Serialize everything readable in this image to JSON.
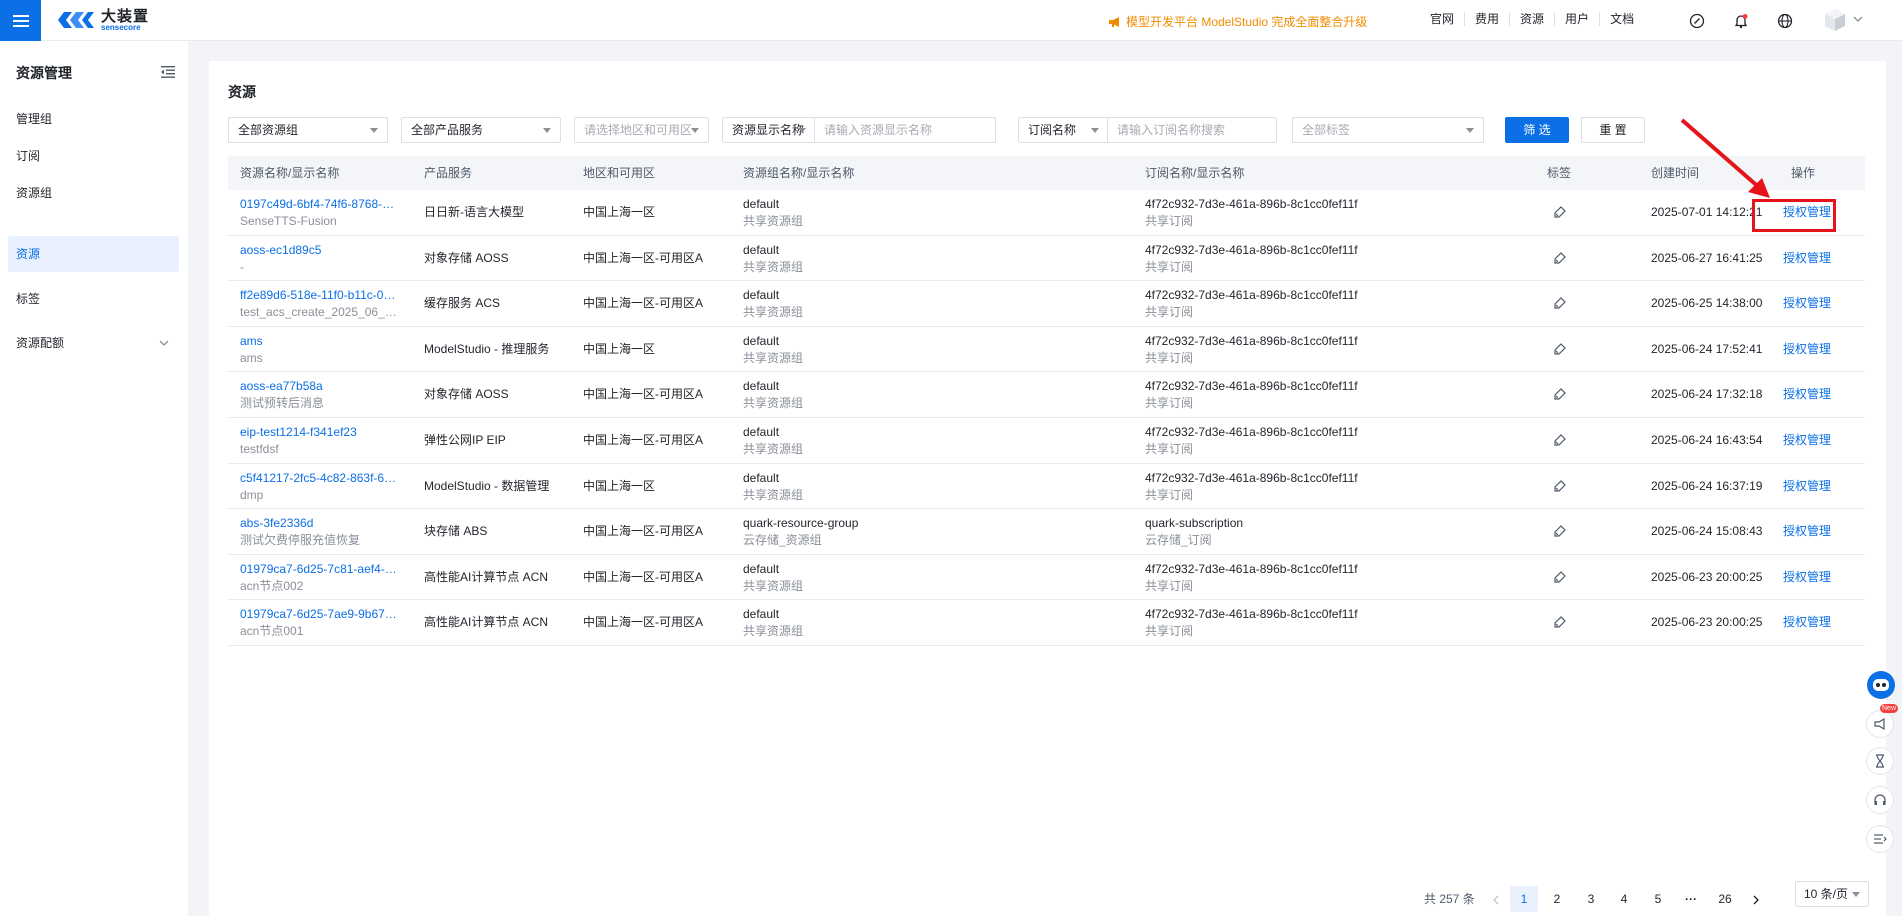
{
  "header": {
    "logo_cn": "大装置",
    "logo_en": "sensecore",
    "notice": "模型开发平台 ModelStudio 完成全面整合升级",
    "nav": [
      "官网",
      "费用",
      "资源",
      "用户",
      "文档"
    ]
  },
  "sidebar": {
    "title": "资源管理",
    "items": [
      {
        "label": "管理组",
        "active": false
      },
      {
        "label": "订阅",
        "active": false
      },
      {
        "label": "资源组",
        "active": false
      },
      {
        "label": "资源",
        "active": true
      },
      {
        "label": "标签",
        "active": false
      },
      {
        "label": "资源配额",
        "active": false
      }
    ]
  },
  "page": {
    "title": "资源"
  },
  "filters": {
    "resource_group": "全部资源组",
    "product": "全部产品服务",
    "region_placeholder": "请选择地区和可用区",
    "display_name_type": "资源显示名称",
    "display_name_placeholder": "请输入资源显示名称",
    "subscription_type": "订阅名称",
    "subscription_placeholder": "请输入订阅名称搜索",
    "tags_placeholder": "全部标签",
    "filter_button": "筛 选",
    "reset_button": "重 置"
  },
  "table": {
    "columns": [
      "资源名称/显示名称",
      "产品服务",
      "地区和可用区",
      "资源组名称/显示名称",
      "订阅名称/显示名称",
      "标签",
      "创建时间",
      "操作"
    ],
    "rows": [
      {
        "name": "0197c49d-6bf4-74f6-8768-c0…",
        "display": "SenseTTS-Fusion",
        "product": "日日新-语言大模型",
        "region": "中国上海一区",
        "group": "default",
        "group_display": "共享资源组",
        "sub": "4f72c932-7d3e-461a-896b-8c1cc0fef11f",
        "sub_display": "共享订阅",
        "time": "2025-07-01 14:12:21",
        "op": "授权管理"
      },
      {
        "name": "aoss-ec1d89c5",
        "display": "-",
        "product": "对象存储 AOSS",
        "region": "中国上海一区-可用区A",
        "group": "default",
        "group_display": "共享资源组",
        "sub": "4f72c932-7d3e-461a-896b-8c1cc0fef11f",
        "sub_display": "共享订阅",
        "time": "2025-06-27 16:41:25",
        "op": "授权管理"
      },
      {
        "name": "ff2e89d6-518e-11f0-b11c-043…",
        "display": "test_acs_create_2025_06_2…",
        "product": "缓存服务 ACS",
        "region": "中国上海一区-可用区A",
        "group": "default",
        "group_display": "共享资源组",
        "sub": "4f72c932-7d3e-461a-896b-8c1cc0fef11f",
        "sub_display": "共享订阅",
        "time": "2025-06-25 14:38:00",
        "op": "授权管理"
      },
      {
        "name": "ams",
        "display": "ams",
        "product": "ModelStudio - 推理服务",
        "region": "中国上海一区",
        "group": "default",
        "group_display": "共享资源组",
        "sub": "4f72c932-7d3e-461a-896b-8c1cc0fef11f",
        "sub_display": "共享订阅",
        "time": "2025-06-24 17:52:41",
        "op": "授权管理"
      },
      {
        "name": "aoss-ea77b58a",
        "display": "测试预转后消息",
        "product": "对象存储 AOSS",
        "region": "中国上海一区-可用区A",
        "group": "default",
        "group_display": "共享资源组",
        "sub": "4f72c932-7d3e-461a-896b-8c1cc0fef11f",
        "sub_display": "共享订阅",
        "time": "2025-06-24 17:32:18",
        "op": "授权管理"
      },
      {
        "name": "eip-test1214-f341ef23",
        "display": "testfdsf",
        "product": "弹性公网IP EIP",
        "region": "中国上海一区-可用区A",
        "group": "default",
        "group_display": "共享资源组",
        "sub": "4f72c932-7d3e-461a-896b-8c1cc0fef11f",
        "sub_display": "共享订阅",
        "time": "2025-06-24 16:43:54",
        "op": "授权管理"
      },
      {
        "name": "c5f41217-2fc5-4c82-863f-669…",
        "display": "dmp",
        "product": "ModelStudio - 数据管理",
        "region": "中国上海一区",
        "group": "default",
        "group_display": "共享资源组",
        "sub": "4f72c932-7d3e-461a-896b-8c1cc0fef11f",
        "sub_display": "共享订阅",
        "time": "2025-06-24 16:37:19",
        "op": "授权管理"
      },
      {
        "name": "abs-3fe2336d",
        "display": "测试欠费停服充值恢复",
        "product": "块存储 ABS",
        "region": "中国上海一区-可用区A",
        "group": "quark-resource-group",
        "group_display": "云存储_资源组",
        "sub": "quark-subscription",
        "sub_display": "云存储_订阅",
        "time": "2025-06-24 15:08:43",
        "op": "授权管理"
      },
      {
        "name": "01979ca7-6d25-7c81-aef4-c0…",
        "display": "acn节点002",
        "product": "高性能AI计算节点 ACN",
        "region": "中国上海一区-可用区A",
        "group": "default",
        "group_display": "共享资源组",
        "sub": "4f72c932-7d3e-461a-896b-8c1cc0fef11f",
        "sub_display": "共享订阅",
        "time": "2025-06-23 20:00:25",
        "op": "授权管理"
      },
      {
        "name": "01979ca7-6d25-7ae9-9b67-e…",
        "display": "acn节点001",
        "product": "高性能AI计算节点 ACN",
        "region": "中国上海一区-可用区A",
        "group": "default",
        "group_display": "共享资源组",
        "sub": "4f72c932-7d3e-461a-896b-8c1cc0fef11f",
        "sub_display": "共享订阅",
        "time": "2025-06-23 20:00:25",
        "op": "授权管理"
      }
    ]
  },
  "pagination": {
    "total": "共 257 条",
    "pages": [
      "1",
      "2",
      "3",
      "4",
      "5",
      "···",
      "26"
    ],
    "current": "1",
    "page_size": "10 条/页"
  },
  "floating": {
    "new_badge": "New"
  },
  "colors": {
    "primary": "#0b6fe6",
    "highlight": "#e5141b",
    "notice": "#f08c00"
  }
}
